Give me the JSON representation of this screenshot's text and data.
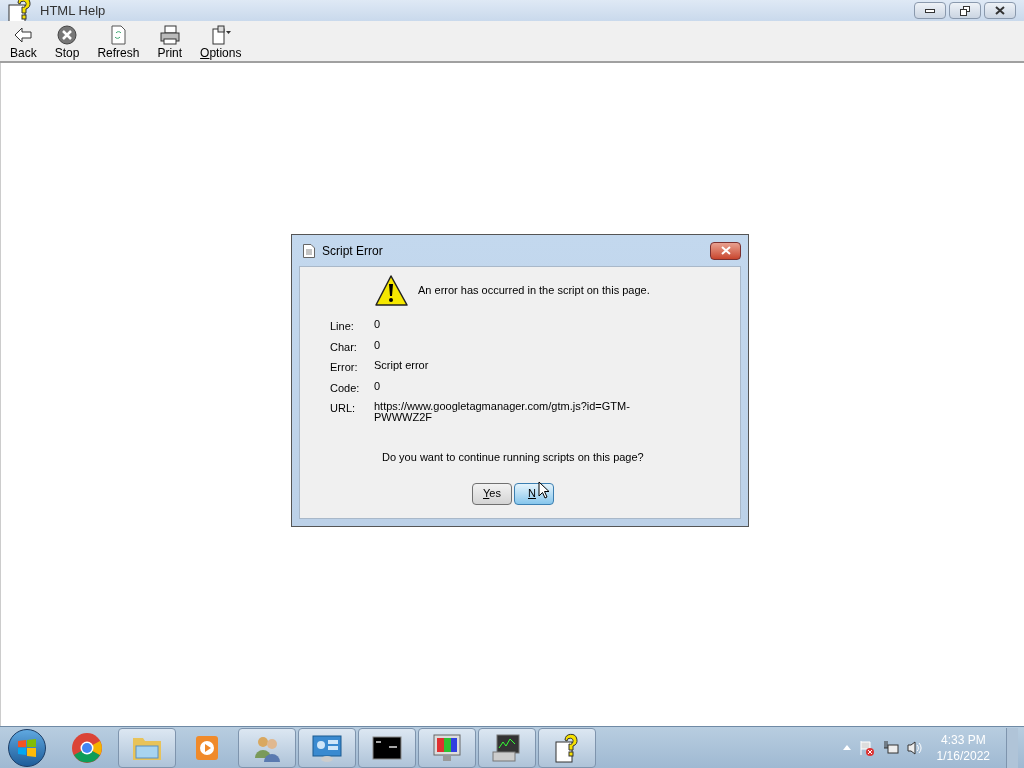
{
  "window": {
    "title": "HTML Help",
    "controls": [
      {
        "kind": "minimize"
      },
      {
        "kind": "restore"
      },
      {
        "kind": "close"
      }
    ]
  },
  "toolbar": [
    {
      "label": "Back",
      "kind": "back",
      "mnemonic": false
    },
    {
      "label": "Stop",
      "kind": "stop",
      "mnemonic": false
    },
    {
      "label": "Refresh",
      "kind": "refresh",
      "mnemonic": false
    },
    {
      "label": "Print",
      "kind": "print",
      "mnemonic": false
    },
    {
      "label": "Options",
      "kind": "options",
      "mnemonic": true
    }
  ],
  "dialog": {
    "title": "Script Error",
    "message": "An error has occurred in the script on this page.",
    "fields": [
      {
        "label": "Line:",
        "value": "0"
      },
      {
        "label": "Char:",
        "value": "0"
      },
      {
        "label": "Error:",
        "value": "Script error"
      },
      {
        "label": "Code:",
        "value": "0"
      },
      {
        "label": "URL:",
        "value": "https://www.googletagmanager.com/gtm.js?id=GTM-\nPWWWZ2F"
      }
    ],
    "question": "Do you want to continue running scripts on this page?",
    "buttons": [
      {
        "label": "Yes",
        "selected": false,
        "mnemonic": true
      },
      {
        "label": "N",
        "selected": true,
        "mnemonic": true
      }
    ]
  },
  "taskbar": {
    "items": [
      {
        "kind": "chrome",
        "running": false
      },
      {
        "kind": "folder",
        "running": true
      },
      {
        "kind": "media",
        "running": false
      },
      {
        "kind": "users",
        "running": true
      },
      {
        "kind": "panel",
        "running": true
      },
      {
        "kind": "console",
        "running": true
      },
      {
        "kind": "monitor",
        "running": true
      },
      {
        "kind": "network",
        "running": true
      },
      {
        "kind": "help",
        "running": true
      }
    ],
    "time": "4:33 PM",
    "date": "1/16/2022"
  }
}
